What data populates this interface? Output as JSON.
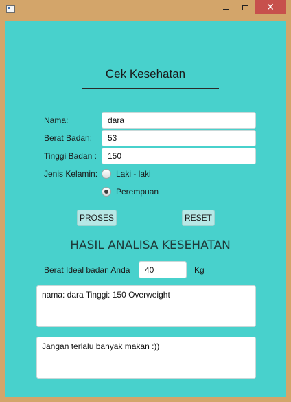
{
  "window": {
    "minimize_glyph": "",
    "maximize_glyph": "",
    "close_glyph": "✕"
  },
  "form": {
    "title": "Cek Kesehatan",
    "name_label": "Nama:",
    "name_value": "dara",
    "weight_label": "Berat Badan:",
    "weight_value": "53",
    "height_label": "Tinggi Badan :",
    "height_value": "150",
    "gender_label": "Jenis Kelamin:",
    "gender_options": [
      "Laki - laki",
      "Perempuan"
    ],
    "gender_selected": "Perempuan"
  },
  "buttons": {
    "process_label": "PROSES",
    "reset_label": "RESET"
  },
  "result": {
    "heading": "HASIL ANALISA KESEHATAN",
    "ideal_label": "Berat Ideal badan Anda",
    "ideal_value": "40",
    "ideal_unit": "Kg",
    "summary_text": "nama: dara Tinggi: 150 Overweight",
    "advice_text": "Jangan terlalu banyak makan :))"
  },
  "colors": {
    "window_frame": "#d3a56a",
    "panel_background": "#48d1cc",
    "close_button": "#c7504c",
    "button_background": "#b6e8e6"
  }
}
